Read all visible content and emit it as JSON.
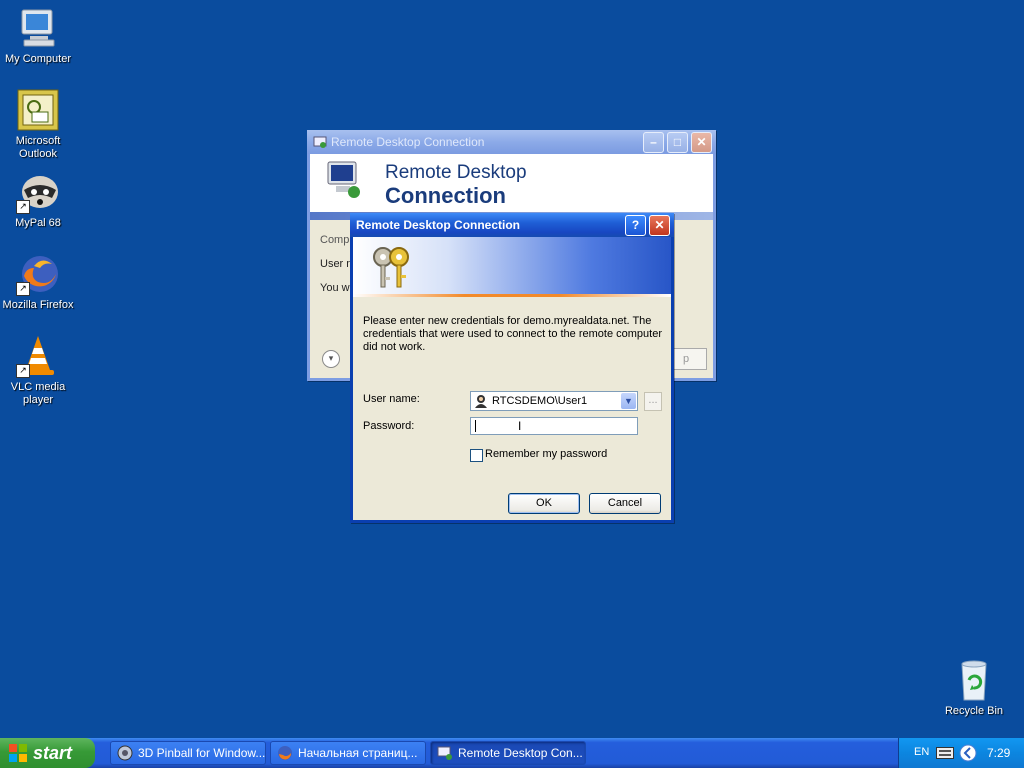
{
  "desktop": {
    "icons": [
      {
        "label": "My Computer",
        "icon": "my-computer-icon"
      },
      {
        "label": "Microsoft Outlook",
        "icon": "outlook-icon"
      },
      {
        "label": "MyPal 68",
        "icon": "mypal-icon"
      },
      {
        "label": "Mozilla Firefox",
        "icon": "firefox-icon"
      },
      {
        "label": "VLC media player",
        "icon": "vlc-icon"
      },
      {
        "label": "Recycle Bin",
        "icon": "recycle-bin-icon"
      }
    ]
  },
  "back_window": {
    "title": "Remote Desktop Connection",
    "banner_line1": "Remote Desktop",
    "banner_line2": "Connection",
    "partial_1": "Compu",
    "partial_2": "User n",
    "partial_3": "You w"
  },
  "dialog": {
    "title": "Remote Desktop Connection",
    "message": "Please enter new credentials for demo.myrealdata.net. The credentials that were used to connect to the remote computer did not work.",
    "username_label": "User name:",
    "username_value": "RTCSDEMO\\User1",
    "password_label": "Password:",
    "password_value": "",
    "remember_label": "Remember my password",
    "remember_checked": false,
    "ok_label": "OK",
    "cancel_label": "Cancel",
    "browse_label": "..."
  },
  "taskbar": {
    "start_label": "start",
    "tasks": [
      {
        "label": "3D Pinball for Window...",
        "icon": "pinball-icon"
      },
      {
        "label": "Начальная страниц...",
        "icon": "firefox-icon"
      },
      {
        "label": "Remote Desktop Con...",
        "icon": "remote-desktop-icon",
        "active": true
      }
    ],
    "language": "EN",
    "clock": "7:29"
  },
  "colors": {
    "desktop": "#0a4c9e",
    "title_active": "#1f5fd6",
    "start_green": "#379a37",
    "tray_blue": "#0c86e0"
  }
}
